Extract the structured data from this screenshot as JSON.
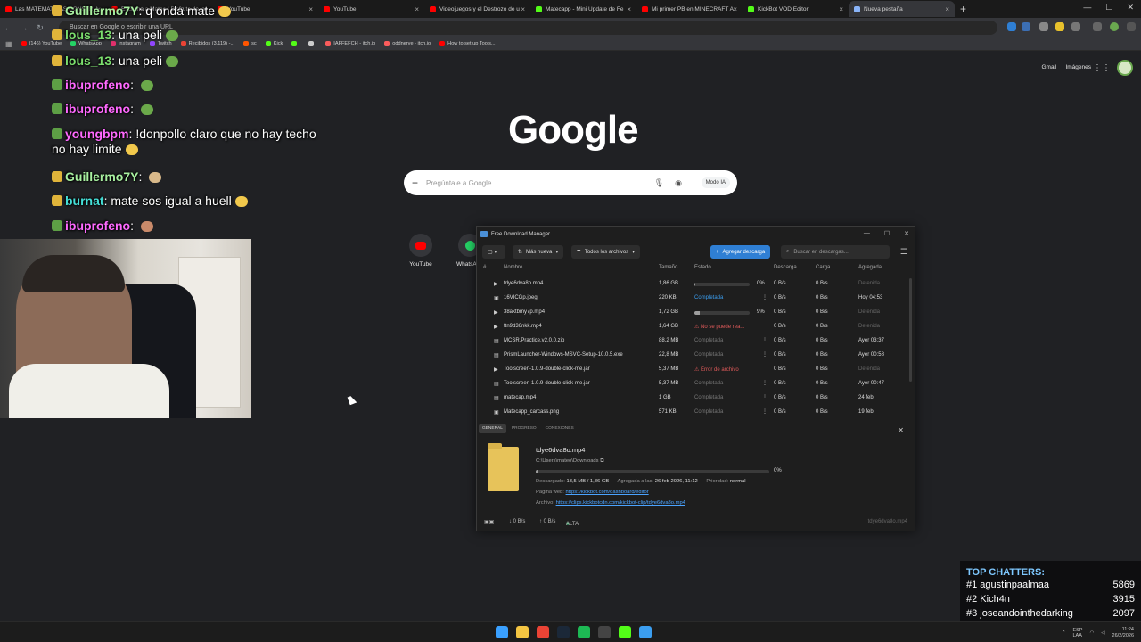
{
  "browser": {
    "tabs": [
      {
        "label": "Las MATEMATICAS CONSTRU",
        "color": "#ff0000"
      },
      {
        "label": "Escucha a Matee | Disfruta de la",
        "color": "#ff0000"
      },
      {
        "label": "YouTube",
        "color": "#ff0000"
      },
      {
        "label": "YouTube",
        "color": "#ff0000"
      },
      {
        "label": "Videojuegos y el Destrozo de u",
        "color": "#ff0000"
      },
      {
        "label": "Matecapp - Mini Update de Fe",
        "color": "#53fc18"
      },
      {
        "label": "Mi primer PB en MINECRAFT A",
        "color": "#ff0000"
      },
      {
        "label": "KickBot VOD Editor",
        "color": "#53fc18"
      },
      {
        "label": "Nueva pestaña",
        "color": "#8ab4f8"
      }
    ],
    "omnibox_placeholder": "Buscar en Google o escribir una URL",
    "bookmarks": [
      {
        "label": "(146) YouTube",
        "color": "#ff0000"
      },
      {
        "label": "WhatsApp",
        "color": "#25d366"
      },
      {
        "label": "Instagram",
        "color": "#e1306c"
      },
      {
        "label": "Twitch",
        "color": "#9146ff"
      },
      {
        "label": "Recibidos (3.119) -...",
        "color": "#ea4335"
      },
      {
        "label": "sc",
        "color": "#ff5500"
      },
      {
        "label": "Kick",
        "color": "#53fc18"
      },
      {
        "label": "",
        "color": "#53fc18"
      },
      {
        "label": "",
        "color": "#cccccc"
      },
      {
        "label": "IAFFEFCH - itch.io",
        "color": "#fa5c5c"
      },
      {
        "label": "oddnerve - itch.io",
        "color": "#fa5c5c"
      },
      {
        "label": "How to set up Tools...",
        "color": "#ff0000"
      }
    ]
  },
  "ntp": {
    "gmail": "Gmail",
    "images": "Imágenes",
    "logo": "Google",
    "search_placeholder": "Pregúntale a Google",
    "modo_ia": "Modo IA",
    "shortcuts": [
      {
        "label": "YouTube",
        "color": "#ff0000"
      },
      {
        "label": "WhatsApp",
        "color": "#25d366"
      }
    ]
  },
  "chat": [
    {
      "user": "Guillermo7Y",
      "user_color": "#a8f0a0",
      "msg": "q onda mate"
    },
    {
      "user": "lous_13",
      "user_color": "#7cdf6e",
      "msg": "una peli"
    },
    {
      "user": "lous_13",
      "user_color": "#7cdf6e",
      "msg": "una peli"
    },
    {
      "user": "ibuprofeno",
      "user_color": "#ff69ff",
      "msg": ""
    },
    {
      "user": "ibuprofeno",
      "user_color": "#ff69ff",
      "msg": ""
    },
    {
      "user": "youngbpm",
      "user_color": "#ff69ff",
      "msg": "!donpollo claro que no hay techo no hay limite"
    },
    {
      "user": "Guillermo7Y",
      "user_color": "#a8f0a0",
      "msg": ""
    },
    {
      "user": "burnat",
      "user_color": "#45e0d8",
      "msg": "mate sos igual a huell"
    },
    {
      "user": "ibuprofeno",
      "user_color": "#ff69ff",
      "msg": ""
    }
  ],
  "fdm": {
    "title": "Free Download Manager",
    "sort": "Más nueva",
    "filter": "Todos los archivos",
    "add": "Agregar descarga",
    "search_placeholder": "Buscar en descargas...",
    "columns": {
      "num": "#",
      "name": "Nombre",
      "size": "Tamaño",
      "status": "Estado",
      "download": "Descarga",
      "upload": "Carga",
      "added": "Agregada"
    },
    "rows": [
      {
        "icon": "play",
        "name": "tdye6dva8o.mp4",
        "size": "1,86 GB",
        "status": "",
        "progress": 0.01,
        "pct": "0%",
        "dl": "0 B/s",
        "up": "0 B/s",
        "added": "Detenida",
        "added_dim": true
      },
      {
        "icon": "image",
        "name": "16VICGp.jpeg",
        "size": "220 KB",
        "status": "Completada",
        "status_type": "ok",
        "dl": "0 B/s",
        "up": "0 B/s",
        "added": "Hoy 04:53"
      },
      {
        "icon": "play",
        "name": "38aktbmy7p.mp4",
        "size": "1,72 GB",
        "status": "",
        "progress": 0.09,
        "pct": "9%",
        "dl": "0 B/s",
        "up": "0 B/s",
        "added": "Detenida",
        "added_dim": true
      },
      {
        "icon": "play",
        "name": "ftn9d36nkk.mp4",
        "size": "1,64 GB",
        "status": "⚠ No se puede rea...",
        "status_type": "err",
        "dl": "0 B/s",
        "up": "0 B/s",
        "added": "Detenida",
        "added_dim": true
      },
      {
        "icon": "file",
        "name": "MCSR.Practice.v2.0.0.zip",
        "size": "88,2 MB",
        "status": "Completada",
        "status_type": "dim",
        "dl": "0 B/s",
        "up": "0 B/s",
        "added": "Ayer 03:37"
      },
      {
        "icon": "file",
        "name": "PrismLauncher-Windows-MSVC-Setup-10.0.5.exe",
        "size": "22,8 MB",
        "status": "Completada",
        "status_type": "dim",
        "dl": "0 B/s",
        "up": "0 B/s",
        "added": "Ayer 00:58"
      },
      {
        "icon": "play",
        "name": "Toolscreen-1.0.9-double-click-me.jar",
        "size": "5,37 MB",
        "status": "⚠ Error de archivo",
        "status_type": "err",
        "dl": "0 B/s",
        "up": "0 B/s",
        "added": "Detenida",
        "added_dim": true
      },
      {
        "icon": "file",
        "name": "Toolscreen-1.0.9-double-click-me.jar",
        "size": "5,37 MB",
        "status": "Completada",
        "status_type": "dim",
        "dl": "0 B/s",
        "up": "0 B/s",
        "added": "Ayer 00:47"
      },
      {
        "icon": "file",
        "name": "matecap.mp4",
        "size": "1 GB",
        "status": "Completada",
        "status_type": "dim",
        "dl": "0 B/s",
        "up": "0 B/s",
        "added": "24 feb"
      },
      {
        "icon": "image",
        "name": "Matecapp_carcass.png",
        "size": "571 KB",
        "status": "Completada",
        "status_type": "dim",
        "dl": "0 B/s",
        "up": "0 B/s",
        "added": "19 feb"
      }
    ],
    "tabs": [
      "GENERAL",
      "PROGRESO",
      "CONEXIONES"
    ],
    "detail": {
      "name": "tdye6dva8o.mp4",
      "path": "C:\\Users\\mateo\\Downloads",
      "progress": 0.01,
      "pct": "0%",
      "downloaded_label": "Descargado:",
      "downloaded": "13,5 MB / 1,86 GB",
      "added_label": "Agregada a las:",
      "added": "26 feb 2026, 11:12",
      "priority_label": "Prioridad:",
      "priority": "normal",
      "web_label": "Página web:",
      "web": "https://kickbot.com/dashboard/editor",
      "file_label": "Archivo:",
      "file": "https://clips.kickbotcdn.com/kickbot-clip/tdye6dva8o.mp4"
    },
    "status": {
      "dl": "↓ 0 B/s",
      "up": "↑ 0 B/s",
      "priority": "ALTA",
      "right": "tdye6dva8o.mp4"
    }
  },
  "top_chatters": {
    "title": "TOP CHATTERS:",
    "rows": [
      {
        "name": "#1 agustinpaalmaa",
        "count": "5869"
      },
      {
        "name": "#2 Kich4n",
        "count": "3915"
      },
      {
        "name": "#3 joseandointhedarking",
        "count": "2097"
      }
    ]
  },
  "taskbar": {
    "lang": "ESP\nLAA",
    "time": "11:24",
    "date": "26/2/2026",
    "apps": [
      {
        "name": "windows",
        "color": "#3aa0ff"
      },
      {
        "name": "explorer",
        "color": "#f4c542"
      },
      {
        "name": "chrome",
        "color": "#ea4335"
      },
      {
        "name": "steam",
        "color": "#1b2838"
      },
      {
        "name": "spotify",
        "color": "#1db954"
      },
      {
        "name": "obs",
        "color": "#444444"
      },
      {
        "name": "kick",
        "color": "#53fc18"
      },
      {
        "name": "fdm",
        "color": "#3b9ef0"
      }
    ]
  }
}
